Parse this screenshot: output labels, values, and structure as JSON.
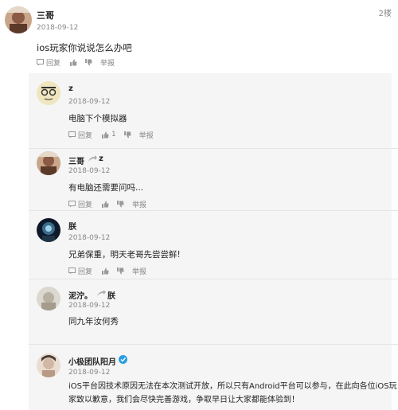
{
  "top_comment": {
    "user": "三哥",
    "date": "2018-09-12",
    "floor": "2楼",
    "text": "ios玩家你说说怎么办吧",
    "reply_label": "回复",
    "like_count": "",
    "report_label": "举报"
  },
  "replies": [
    {
      "user": "z",
      "reply_to": "",
      "date": "2018-09-12",
      "text": "电脑下个模拟器",
      "reply_label": "回复",
      "like_count": "1",
      "report_label": "举报"
    },
    {
      "user": "三哥",
      "reply_to": "z",
      "date": "2018-09-12",
      "text": "有电脑还需要问吗...",
      "reply_label": "回复",
      "like_count": "",
      "report_label": "举报"
    },
    {
      "user": "朕",
      "reply_to": "",
      "date": "2018-09-12",
      "text": "兄弟保重，明天老哥先尝尝鲜!",
      "reply_label": "回复",
      "like_count": "",
      "report_label": "举报"
    },
    {
      "user": "泥泞。",
      "reply_to": "朕",
      "date": "2018-09-12",
      "text": "同九年汝何秀",
      "reply_label": "",
      "like_count": "",
      "report_label": ""
    },
    {
      "user": "小极团队阳月",
      "reply_to": "",
      "date": "2018-09-12",
      "verified": true,
      "text_line1": "iOS平台因技术原因无法在本次测试开放，所以只有Android平台可以参与，在此向各位iOS玩",
      "text_line2": "家致以歉意，我们会尽快完善游戏，争取早日让大家都能体验到！"
    }
  ],
  "colors": {
    "reply_background": "#f5f5f5",
    "verified_badge": "#2a9ee0"
  }
}
